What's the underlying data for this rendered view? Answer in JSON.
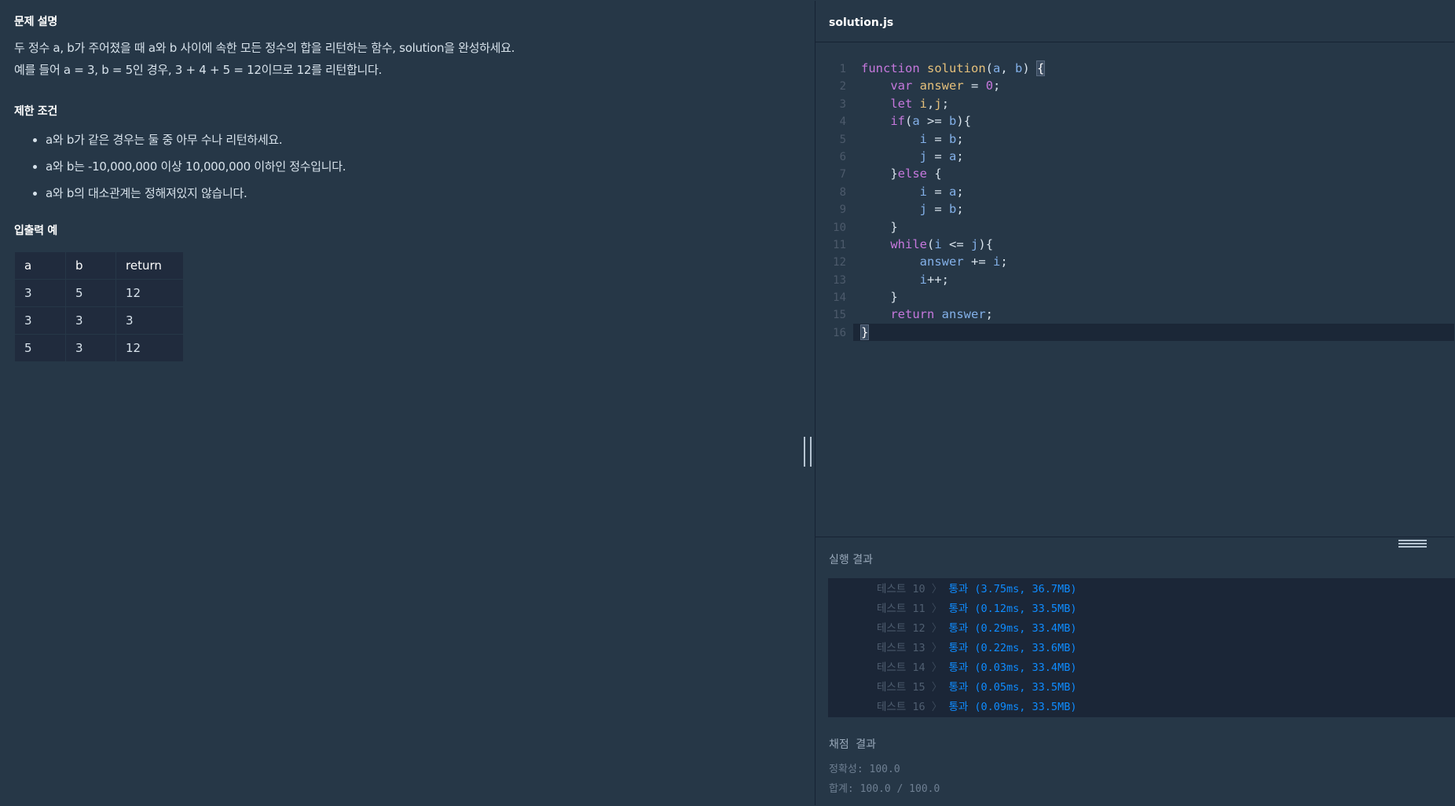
{
  "problem": {
    "title": "문제 설명",
    "description": [
      "두 정수 a, b가 주어졌을 때 a와 b 사이에 속한 모든 정수의 합을 리턴하는 함수, solution을 완성하세요.",
      "예를 들어 a = 3, b = 5인 경우, 3 + 4 + 5 = 12이므로 12를 리턴합니다."
    ],
    "constraints_title": "제한 조건",
    "constraints": [
      "a와 b가 같은 경우는 둘 중 아무 수나 리턴하세요.",
      "a와 b는 -10,000,000 이상 10,000,000 이하인 정수입니다.",
      "a와 b의 대소관계는 정해져있지 않습니다."
    ],
    "io_title": "입출력 예",
    "io_table": {
      "headers": [
        "a",
        "b",
        "return"
      ],
      "rows": [
        [
          "3",
          "5",
          "12"
        ],
        [
          "3",
          "3",
          "3"
        ],
        [
          "5",
          "3",
          "12"
        ]
      ]
    }
  },
  "editor": {
    "filename": "solution.js",
    "line_numbers": [
      "1",
      "2",
      "3",
      "4",
      "5",
      "6",
      "7",
      "8",
      "9",
      "10",
      "11",
      "12",
      "13",
      "14",
      "15",
      "16"
    ]
  },
  "results": {
    "title": "실행 결과",
    "rows": [
      {
        "label": "테스트 10",
        "sep": "〉",
        "result": "통과 (3.75ms, 36.7MB)"
      },
      {
        "label": "테스트 11",
        "sep": "〉",
        "result": "통과 (0.12ms, 33.5MB)"
      },
      {
        "label": "테스트 12",
        "sep": "〉",
        "result": "통과 (0.29ms, 33.4MB)"
      },
      {
        "label": "테스트 13",
        "sep": "〉",
        "result": "통과 (0.22ms, 33.6MB)"
      },
      {
        "label": "테스트 14",
        "sep": "〉",
        "result": "통과 (0.03ms, 33.4MB)"
      },
      {
        "label": "테스트 15",
        "sep": "〉",
        "result": "통과 (0.05ms, 33.5MB)"
      },
      {
        "label": "테스트 16",
        "sep": "〉",
        "result": "통과 (0.09ms, 33.5MB)"
      }
    ]
  },
  "grading": {
    "title": "채점 결과",
    "accuracy": "정확성: 100.0",
    "total": "합계: 100.0 / 100.0"
  },
  "colors": {
    "background": "#263747",
    "pass": "#0f8cff",
    "keyword": "#c678dd",
    "identifier": "#e5c07b"
  }
}
